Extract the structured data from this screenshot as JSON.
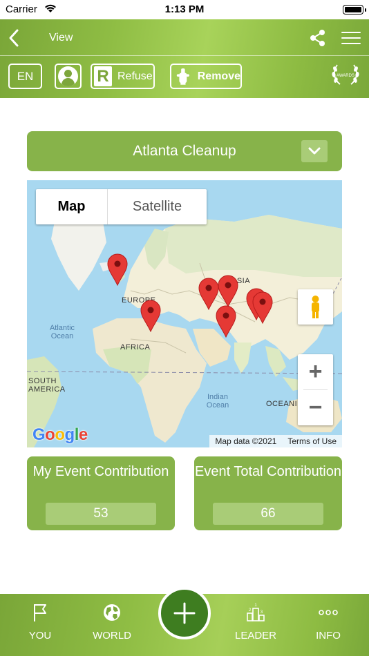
{
  "status_bar": {
    "carrier": "Carrier",
    "time": "1:13 PM"
  },
  "header": {
    "title": "View",
    "language": "EN",
    "refuse_label": "Refuse",
    "refuse_letter": "R",
    "remove_label": "Remove",
    "awards_label": "AWARDS"
  },
  "event": {
    "name": "Atlanta Cleanup"
  },
  "map": {
    "type_options": [
      "Map",
      "Satellite"
    ],
    "selected_type": "Map",
    "labels": {
      "europe": "EUROPE",
      "africa": "AFRICA",
      "south_america": "SOUTH AMERICA",
      "asia": "ASIA",
      "oceania": "OCEANI",
      "atlantic": "Atlantic Ocean",
      "indian": "Indian Ocean"
    },
    "google": "Google",
    "attribution": "Map data ©2021",
    "terms": "Terms of Use",
    "zoom_in": "+",
    "zoom_out": "−",
    "pin_count": 8
  },
  "stats": {
    "my_label": "My Event Contribution",
    "my_value": "53",
    "total_label": "Event Total Contribution",
    "total_value": "66"
  },
  "tabbar": {
    "you": "YOU",
    "world": "WORLD",
    "leader": "LEADER",
    "info": "INFO"
  },
  "colors": {
    "brand_green": "#87b34a",
    "brand_green_light": "#a9cc77",
    "add_button": "#3e7d20",
    "pin_red": "#e53935"
  }
}
